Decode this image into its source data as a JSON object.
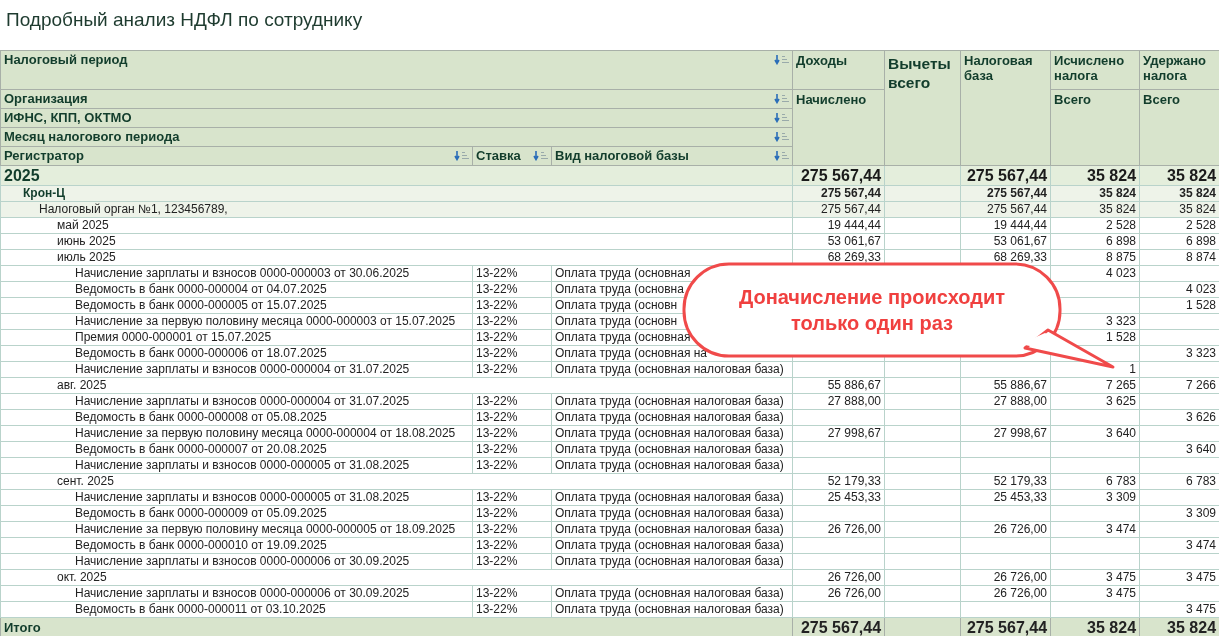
{
  "title": "Подробный анализ НДФЛ по сотруднику",
  "header": {
    "row_groups": [
      {
        "label": "Налоговый период"
      },
      {
        "label": "Организация"
      },
      {
        "label": "ИФНС, КПП, ОКТМО"
      },
      {
        "label": "Месяц налогового периода"
      }
    ],
    "columns": [
      {
        "label": "Регистратор"
      },
      {
        "label": "Ставка"
      },
      {
        "label": "Вид налоговой базы"
      }
    ],
    "measures": [
      {
        "label": "Доходы",
        "sublabel": "Начислено"
      },
      {
        "label": "Вычеты всего"
      },
      {
        "label": "Налоговая база"
      },
      {
        "label": "Исчислено налога",
        "sublabel": "Всего"
      },
      {
        "label": "Удержано налога",
        "sublabel": "Всего"
      }
    ]
  },
  "rows": [
    {
      "kind": "year",
      "label": "2025",
      "income": "275 567,44",
      "base": "275 567,44",
      "calculated": "35 824",
      "withheld": "35 824",
      "children": [
        {
          "kind": "organization",
          "label": "Крон-Ц",
          "income": "275 567,44",
          "base": "275 567,44",
          "calculated": "35 824",
          "withheld": "35 824",
          "children": [
            {
              "kind": "tax_office",
              "label": "Налоговый орган №1, 123456789,",
              "income": "275 567,44",
              "base": "275 567,44",
              "calculated": "35 824",
              "withheld": "35 824",
              "children": [
                {
                  "kind": "month",
                  "label": "май 2025",
                  "income": "19 444,44",
                  "base": "19 444,44",
                  "calculated": "2 528",
                  "withheld": "2 528"
                },
                {
                  "kind": "month",
                  "label": "июнь 2025",
                  "income": "53 061,67",
                  "base": "53 061,67",
                  "calculated": "6 898",
                  "withheld": "6 898"
                },
                {
                  "kind": "month",
                  "label": "июль 2025",
                  "income": "68 269,33",
                  "base": "68 269,33",
                  "calculated": "8 875",
                  "withheld": "8 874",
                  "children": [
                    {
                      "kind": "document",
                      "label": "Начисление зарплаты и взносов 0000-000003 от 30.06.2025",
                      "rate": "13-22%",
                      "base_type": "Оплата труда (основная",
                      "calculated": "4 023"
                    },
                    {
                      "kind": "document",
                      "label": "Ведомость в банк 0000-000004 от 04.07.2025",
                      "rate": "13-22%",
                      "base_type": "Оплата труда (основна",
                      "withheld": "4 023"
                    },
                    {
                      "kind": "document",
                      "label": "Ведомость в банк 0000-000005 от 15.07.2025",
                      "rate": "13-22%",
                      "base_type": "Оплата труда (основн",
                      "withheld": "1 528"
                    },
                    {
                      "kind": "document",
                      "label": "Начисление за первую половину месяца 0000-000003 от 15.07.2025",
                      "rate": "13-22%",
                      "base_type": "Оплата труда (основн",
                      "calculated": "3 323"
                    },
                    {
                      "kind": "document",
                      "label": "Премия 0000-000001 от 15.07.2025",
                      "rate": "13-22%",
                      "base_type": "Оплата труда (основная",
                      "calculated": "1 528"
                    },
                    {
                      "kind": "document",
                      "label": "Ведомость в банк 0000-000006 от 18.07.2025",
                      "rate": "13-22%",
                      "base_type": "Оплата труда (основная на",
                      "withheld": "3 323"
                    },
                    {
                      "kind": "document",
                      "label": "Начисление зарплаты и взносов 0000-000004 от 31.07.2025",
                      "rate": "13-22%",
                      "base_type": "Оплата труда (основная налоговая база)",
                      "calculated": "1"
                    }
                  ]
                },
                {
                  "kind": "month",
                  "label": "авг. 2025",
                  "income": "55 886,67",
                  "base": "55 886,67",
                  "calculated": "7 265",
                  "withheld": "7 266",
                  "children": [
                    {
                      "kind": "document",
                      "label": "Начисление зарплаты и взносов 0000-000004 от 31.07.2025",
                      "rate": "13-22%",
                      "base_type": "Оплата труда (основная налоговая база)",
                      "income": "27 888,00",
                      "base": "27 888,00",
                      "calculated": "3 625"
                    },
                    {
                      "kind": "document",
                      "label": "Ведомость в банк 0000-000008 от 05.08.2025",
                      "rate": "13-22%",
                      "base_type": "Оплата труда (основная налоговая база)",
                      "withheld": "3 626"
                    },
                    {
                      "kind": "document",
                      "label": "Начисление за первую половину месяца 0000-000004 от 18.08.2025",
                      "rate": "13-22%",
                      "base_type": "Оплата труда (основная налоговая база)",
                      "income": "27 998,67",
                      "base": "27 998,67",
                      "calculated": "3 640"
                    },
                    {
                      "kind": "document",
                      "label": "Ведомость в банк 0000-000007 от 20.08.2025",
                      "rate": "13-22%",
                      "base_type": "Оплата труда (основная налоговая база)",
                      "withheld": "3 640"
                    },
                    {
                      "kind": "document",
                      "label": "Начисление зарплаты и взносов 0000-000005 от 31.08.2025",
                      "rate": "13-22%",
                      "base_type": "Оплата труда (основная налоговая база)"
                    }
                  ]
                },
                {
                  "kind": "month",
                  "label": "сент. 2025",
                  "income": "52 179,33",
                  "base": "52 179,33",
                  "calculated": "6 783",
                  "withheld": "6 783",
                  "children": [
                    {
                      "kind": "document",
                      "label": "Начисление зарплаты и взносов 0000-000005 от 31.08.2025",
                      "rate": "13-22%",
                      "base_type": "Оплата труда (основная налоговая база)",
                      "income": "25 453,33",
                      "base": "25 453,33",
                      "calculated": "3 309"
                    },
                    {
                      "kind": "document",
                      "label": "Ведомость в банк 0000-000009 от 05.09.2025",
                      "rate": "13-22%",
                      "base_type": "Оплата труда (основная налоговая база)",
                      "withheld": "3 309"
                    },
                    {
                      "kind": "document",
                      "label": "Начисление за первую половину месяца 0000-000005 от 18.09.2025",
                      "rate": "13-22%",
                      "base_type": "Оплата труда (основная налоговая база)",
                      "income": "26 726,00",
                      "base": "26 726,00",
                      "calculated": "3 474"
                    },
                    {
                      "kind": "document",
                      "label": "Ведомость в банк 0000-000010 от 19.09.2025",
                      "rate": "13-22%",
                      "base_type": "Оплата труда (основная налоговая база)",
                      "withheld": "3 474"
                    },
                    {
                      "kind": "document",
                      "label": "Начисление зарплаты и взносов 0000-000006 от 30.09.2025",
                      "rate": "13-22%",
                      "base_type": "Оплата труда (основная налоговая база)"
                    }
                  ]
                },
                {
                  "kind": "month",
                  "label": "окт. 2025",
                  "income": "26 726,00",
                  "base": "26 726,00",
                  "calculated": "3 475",
                  "withheld": "3 475",
                  "children": [
                    {
                      "kind": "document",
                      "label": "Начисление зарплаты и взносов 0000-000006 от 30.09.2025",
                      "rate": "13-22%",
                      "base_type": "Оплата труда (основная налоговая база)",
                      "income": "26 726,00",
                      "base": "26 726,00",
                      "calculated": "3 475"
                    },
                    {
                      "kind": "document",
                      "label": "Ведомость в банк 0000-000011 от 03.10.2025",
                      "rate": "13-22%",
                      "base_type": "Оплата труда (основная налоговая база)",
                      "withheld": "3 475"
                    }
                  ]
                }
              ]
            }
          ]
        }
      ]
    }
  ],
  "total": {
    "label": "Итого",
    "income": "275 567,44",
    "base": "275 567,44",
    "calculated": "35 824",
    "withheld": "35 824"
  },
  "callout": {
    "text": "Доначисление происходит только один раз"
  }
}
